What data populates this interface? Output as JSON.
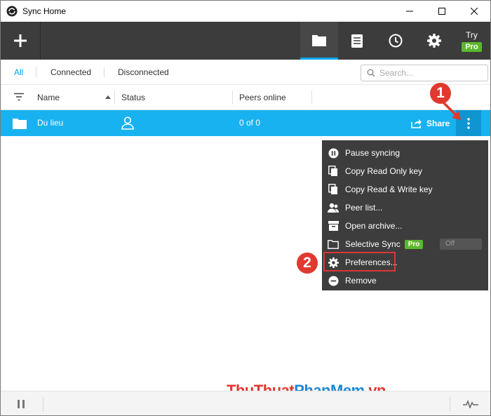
{
  "window": {
    "title": "Sync Home"
  },
  "toolbar": {
    "try_label": "Try",
    "pro_label": "Pro"
  },
  "filters": {
    "tabs": [
      "All",
      "Connected",
      "Disconnected"
    ],
    "active": "All",
    "search_placeholder": "Search..."
  },
  "columns": {
    "name": "Name",
    "status": "Status",
    "peers": "Peers online"
  },
  "folders": [
    {
      "name": "Du lieu",
      "peers": "0 of 0",
      "share_label": "Share"
    }
  ],
  "menu": {
    "items": [
      {
        "label": "Pause syncing",
        "icon": "pause-circle-icon"
      },
      {
        "label": "Copy Read Only key",
        "icon": "copy-icon"
      },
      {
        "label": "Copy Read & Write key",
        "icon": "copy-icon"
      },
      {
        "label": "Peer list...",
        "icon": "people-icon"
      },
      {
        "label": "Open archive...",
        "icon": "archive-icon"
      },
      {
        "label": "Selective Sync",
        "icon": "folder-icon",
        "badge": "Pro",
        "toggle": "Off"
      },
      {
        "label": "Preferences...",
        "icon": "gear-icon"
      },
      {
        "label": "Remove",
        "icon": "minus-circle-icon"
      }
    ]
  },
  "annotations": {
    "step1": "1",
    "step2": "2"
  },
  "watermark": {
    "part1": "ThuThuat",
    "part2": "PhanMem",
    "part3": ".vn"
  },
  "colors": {
    "accent": "#00a9ec",
    "row_selected": "#18b2f1",
    "toolbar": "#3c3c3c",
    "menu": "#3d3d3d",
    "pro_green": "#5cb82e",
    "annotation_red": "#e0392f"
  }
}
